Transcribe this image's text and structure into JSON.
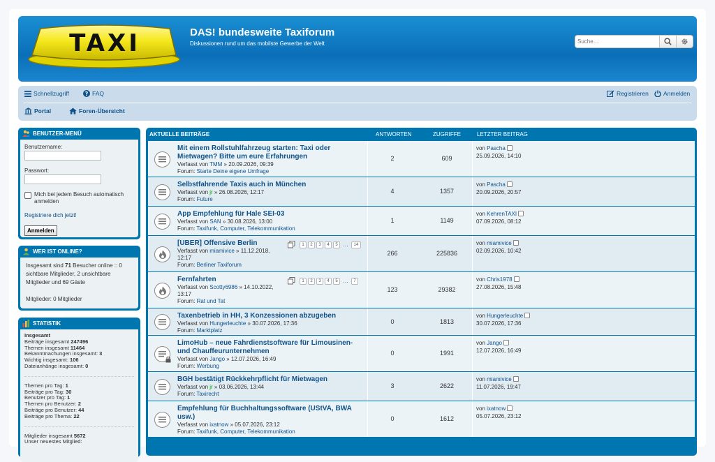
{
  "header": {
    "logo_text": "TAXI",
    "title": "DAS! bundesweite Taxiforum",
    "description": "Diskussionen rund um das mobilste Gewerbe der Welt",
    "search_placeholder": "Suche…"
  },
  "nav": {
    "quick_access": "Schnellzugriff",
    "faq": "FAQ",
    "register": "Registrieren",
    "login": "Anmelden",
    "portal": "Portal",
    "forum_index": "Foren-Übersicht"
  },
  "user_menu": {
    "title": "Benutzer-Menü",
    "username_label": "Benutzername:",
    "password_label": "Passwort:",
    "remember_label": "Mich bei jedem Besuch automatisch anmelden",
    "register_link": "Registriere dich jetzt!",
    "login_button": "Anmelden"
  },
  "online": {
    "title": "Wer ist online?",
    "text_before": "Insgesamt sind ",
    "count": "71",
    "text_after": " Besucher online :: 0 sichtbare Mitglieder, 2 unsichtbare Mitglieder und 69 Gäste",
    "members": "Mitglieder: 0 Mitglieder"
  },
  "stats": {
    "title": "Statistik",
    "heading": "Insgesamt",
    "group1": [
      {
        "label": "Beiträge insgesamt ",
        "value": "247496"
      },
      {
        "label": "Themen insgesamt ",
        "value": "11464"
      },
      {
        "label": "Bekanntmachungen insgesamt: ",
        "value": "3"
      },
      {
        "label": "Wichtig insgesamt: ",
        "value": "106"
      },
      {
        "label": "Dateianhänge insgesamt: ",
        "value": "0"
      }
    ],
    "group2": [
      {
        "label": "Themen pro Tag: ",
        "value": "1"
      },
      {
        "label": "Beiträge pro Tag: ",
        "value": "30"
      },
      {
        "label": "Benutzer pro Tag: ",
        "value": "1"
      },
      {
        "label": "Themen pro Benutzer: ",
        "value": "2"
      },
      {
        "label": "Beiträge pro Benutzer: ",
        "value": "44"
      },
      {
        "label": "Beiträge pro Thema: ",
        "value": "22"
      }
    ],
    "group3": [
      {
        "label": "Mitglieder insgesamt ",
        "value": "5672"
      },
      {
        "label": "Unser neuestes Mitglied:",
        "value": ""
      }
    ]
  },
  "forum": {
    "headers": {
      "topics": "Aktuelle Beiträge",
      "answers": "Antworten",
      "views": "Zugriffe",
      "last": "Letzter Beitrag"
    },
    "rows": [
      {
        "title": "Mit einem Rollstuhlfahrzeug starten: Taxi oder Mietwagen? Bitte um eure Erfahrungen",
        "by": "Verfasst von ",
        "author": "TMM",
        "author_green": false,
        "date": " » 20.09.2026, 09:39",
        "forum": "Forum: ",
        "forum_name": "Starte Deine eigene Umfrage",
        "answers": "2",
        "views": "609",
        "last_by": "von ",
        "last_user": "Pascha",
        "last_date": "25.09.2026, 14:10",
        "icon": "topic"
      },
      {
        "title": "Selbstfahrende Taxis auch in München",
        "by": "Verfasst von ",
        "author": "jr",
        "author_green": true,
        "date": " » 26.08.2026, 12:17",
        "forum": "Forum: ",
        "forum_name": "Future",
        "answers": "4",
        "views": "1357",
        "last_by": "von ",
        "last_user": "Pascha",
        "last_date": "20.09.2026, 20:57",
        "icon": "topic"
      },
      {
        "title": "App Empfehlung für Hale SEI-03",
        "by": "Verfasst von ",
        "author": "SAN",
        "author_green": false,
        "date": " » 30.08.2026, 13:00",
        "forum": "Forum: ",
        "forum_name": "Taxifunk, Computer, Telekommunikation",
        "answers": "1",
        "views": "1149",
        "last_by": "von ",
        "last_user": "KehrenTAXI",
        "last_date": "07.09.2026, 08:12",
        "icon": "topic"
      },
      {
        "title": "[UBER] Offensive Berlin",
        "by": "Verfasst von ",
        "author": "miamivice",
        "author_green": false,
        "date": " » 11.12.2018, 12:17",
        "forum": "Forum: ",
        "forum_name": "Berliner Taxiforum",
        "answers": "266",
        "views": "225836",
        "last_by": "von ",
        "last_user": "miamivice",
        "last_date": "02.09.2026, 10:42",
        "icon": "hot",
        "pages": [
          "1",
          "2",
          "3",
          "4",
          "5",
          "...",
          "14"
        ]
      },
      {
        "title": "Fernfahrten",
        "by": "Verfasst von ",
        "author": "Scotty6986",
        "author_green": false,
        "date": " » 14.10.2022, 13:17",
        "forum": "Forum: ",
        "forum_name": "Rat und Tat",
        "answers": "123",
        "views": "29382",
        "last_by": "von ",
        "last_user": "Chris1978",
        "last_date": "27.08.2026, 15:48",
        "icon": "hot",
        "pages": [
          "1",
          "2",
          "3",
          "4",
          "5",
          "...",
          "7"
        ]
      },
      {
        "title": "Taxenbetrieb in HH, 3 Konzessionen abzugeben",
        "by": "Verfasst von ",
        "author": "Hungerleuchte",
        "author_green": false,
        "date": " » 30.07.2026, 17:36",
        "forum": "Forum: ",
        "forum_name": "Marktplatz",
        "answers": "0",
        "views": "1813",
        "last_by": "von ",
        "last_user": "Hungerleuchte",
        "last_date": "30.07.2026, 17:36",
        "icon": "topic"
      },
      {
        "title": "LimoHub – neue Fahrdienstsoftware für Limousinen- und Chauffeurunternehmen",
        "by": "Verfasst von ",
        "author": "Jango",
        "author_green": false,
        "date": " » 12.07.2026, 16:49",
        "forum": "Forum: ",
        "forum_name": "Werbung",
        "answers": "0",
        "views": "1991",
        "last_by": "von ",
        "last_user": "Jango",
        "last_date": "12.07.2026, 16:49",
        "icon": "locked"
      },
      {
        "title": "BGH bestätigt Rückkehrpflicht für Mietwagen",
        "by": "Verfasst von ",
        "author": "jr",
        "author_green": true,
        "date": " » 03.06.2026, 13:44",
        "forum": "Forum: ",
        "forum_name": "Taxirecht",
        "answers": "3",
        "views": "2622",
        "last_by": "von ",
        "last_user": "miamivice",
        "last_date": "11.07.2026, 19:47",
        "icon": "topic"
      },
      {
        "title": "Empfehlung für Buchhaltungssoftware (UStVA, BWA usw.)",
        "by": "Verfasst von ",
        "author": "ixatnow",
        "author_green": false,
        "date": " » 05.07.2026, 23:12",
        "forum": "Forum: ",
        "forum_name": "Taxifunk, Computer, Telekommunikation",
        "answers": "0",
        "views": "1612",
        "last_by": "von ",
        "last_user": "ixatnow",
        "last_date": "05.07.2026, 23:12",
        "icon": "topic"
      }
    ]
  },
  "colors": {
    "header_blue": "#0a6fb8",
    "link": "#105289",
    "block_blue": "#0076b1",
    "taxi_yellow": "#f5e81c"
  }
}
